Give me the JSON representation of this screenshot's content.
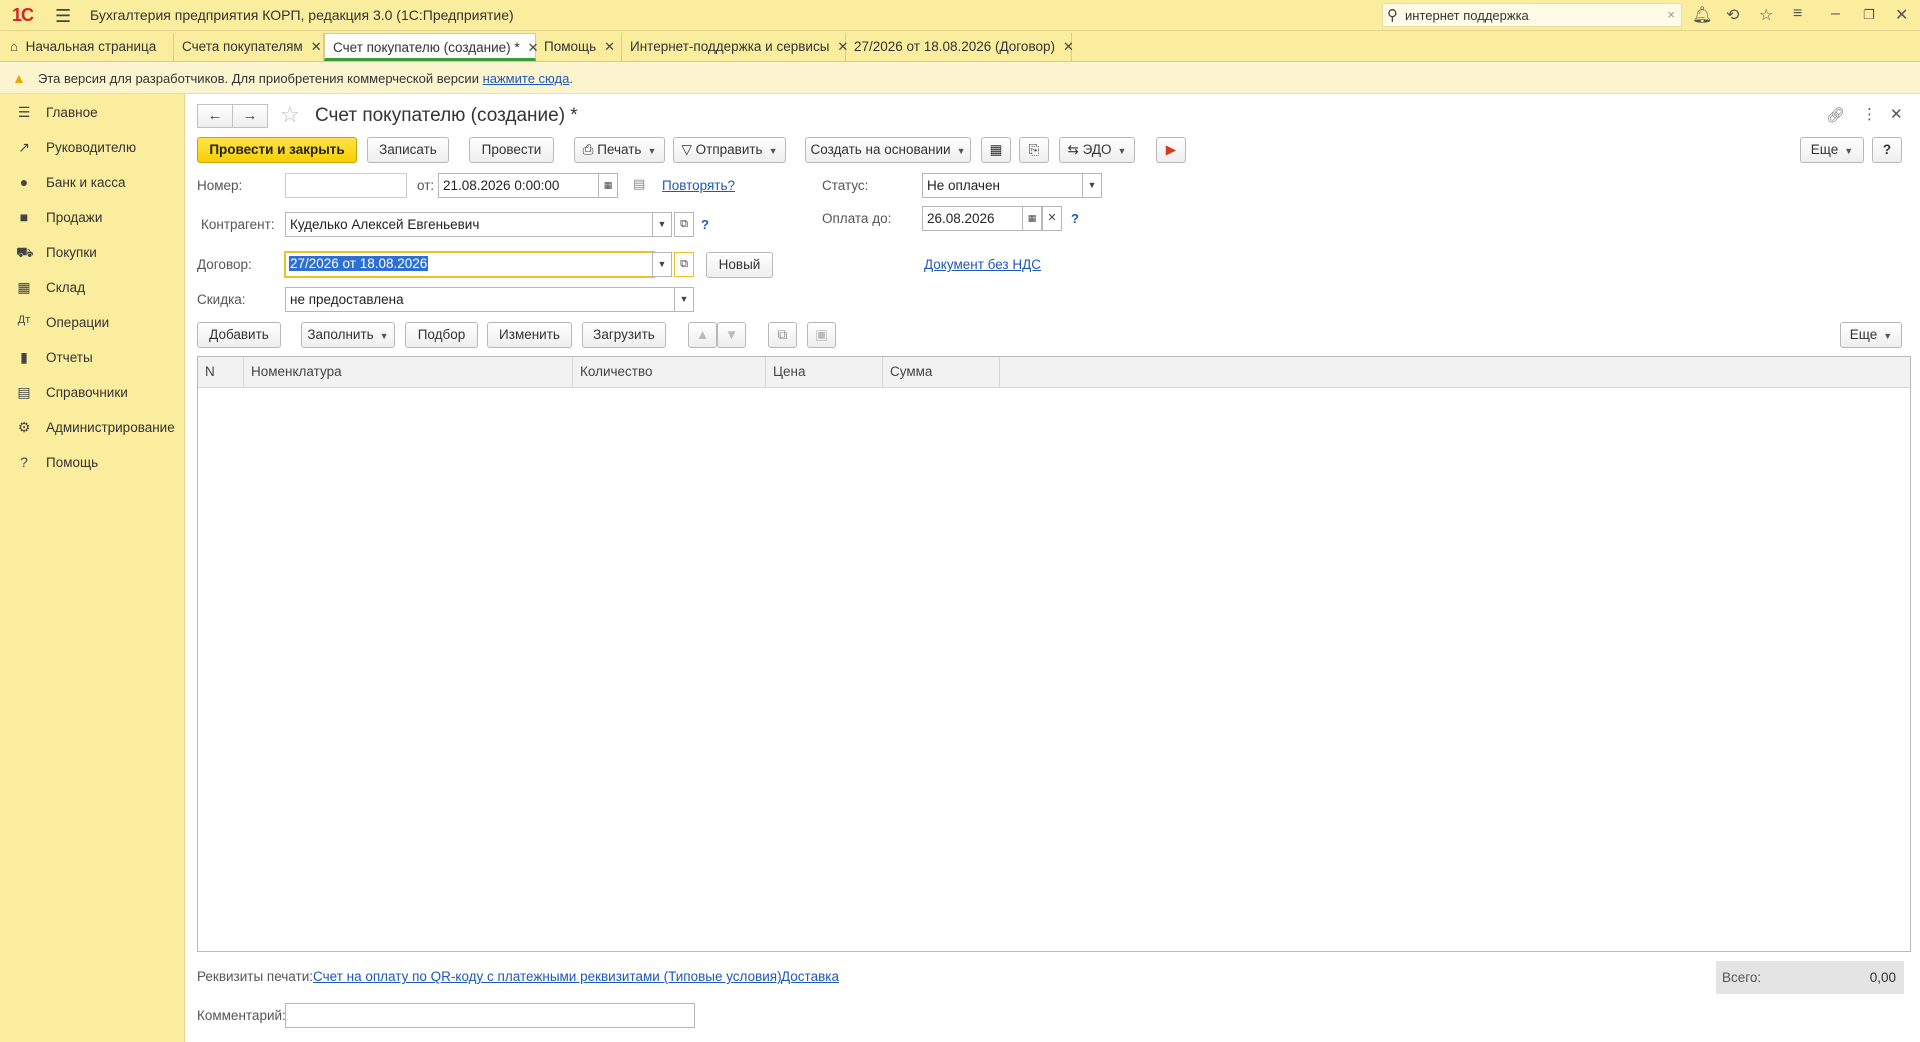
{
  "app": {
    "logo": "1С",
    "title": "Бухгалтерия предприятия КОРП, редакция 3.0  (1С:Предприятие)",
    "search_value": "интернет поддержка"
  },
  "tabs": [
    {
      "label": "Начальная страница"
    },
    {
      "label": "Счета покупателям"
    },
    {
      "label": "Счет покупателю (создание) *"
    },
    {
      "label": "Помощь"
    },
    {
      "label": "Интернет-поддержка и сервисы"
    },
    {
      "label": "27/2026 от 18.08.2026 (Договор)"
    }
  ],
  "warning": {
    "text": "Эта версия для разработчиков. Для приобретения коммерческой версии ",
    "link": "нажмите сюда",
    "tail": "."
  },
  "sidebar": {
    "items": [
      {
        "label": "Главное",
        "icon": "menu-icon"
      },
      {
        "label": "Руководителю",
        "icon": "trend-icon"
      },
      {
        "label": "Банк и касса",
        "icon": "coin-icon"
      },
      {
        "label": "Продажи",
        "icon": "bag-icon"
      },
      {
        "label": "Покупки",
        "icon": "cart-icon"
      },
      {
        "label": "Склад",
        "icon": "warehouse-icon"
      },
      {
        "label": "Операции",
        "icon": "operations-icon"
      },
      {
        "label": "Отчеты",
        "icon": "chart-icon"
      },
      {
        "label": "Справочники",
        "icon": "books-icon"
      },
      {
        "label": "Администрирование",
        "icon": "gear-icon"
      },
      {
        "label": "Помощь",
        "icon": "question-icon"
      }
    ]
  },
  "form": {
    "title": "Счет покупателю (создание) *",
    "toolbar": {
      "post_close": "Провести и закрыть",
      "save": "Записать",
      "post": "Провести",
      "print": "Печать",
      "send": "Отправить",
      "create_based": "Создать на основании",
      "edo": "ЭДО",
      "more": "Еще",
      "help": "?"
    },
    "number_label": "Номер:",
    "number_value": "",
    "date_label": "от:",
    "date_value": "21.08.2026  0:00:00",
    "repeat_link": "Повторять?",
    "status_label": "Статус:",
    "status_value": "Не оплачен",
    "counterparty_label": "Контрагент:",
    "counterparty_value": "Куделько Алексей Евгеньевич",
    "pay_until_label": "Оплата до:",
    "pay_until_value": "26.08.2026",
    "contract_label": "Договор:",
    "contract_value": "27/2026 от 18.08.2026",
    "new_button": "Новый",
    "no_vat_link": "Документ без НДС",
    "discount_label": "Скидка:",
    "discount_value": "не предоставлена",
    "help_mark": "?"
  },
  "table_toolbar": {
    "add": "Добавить",
    "fill": "Заполнить",
    "pick": "Подбор",
    "change": "Изменить",
    "load": "Загрузить",
    "more": "Еще"
  },
  "table": {
    "columns": [
      "N",
      "Номенклатура",
      "Количество",
      "Цена",
      "Сумма"
    ],
    "rows": []
  },
  "footer": {
    "print_details_label": "Реквизиты печати:",
    "print_details_link": "Счет на оплату по QR-коду с платежными реквизитами (Типовые условия)",
    "delivery_link": "Доставка",
    "total_label": "Всего:",
    "total_value": "0,00",
    "comment_label": "Комментарий:",
    "comment_value": ""
  }
}
